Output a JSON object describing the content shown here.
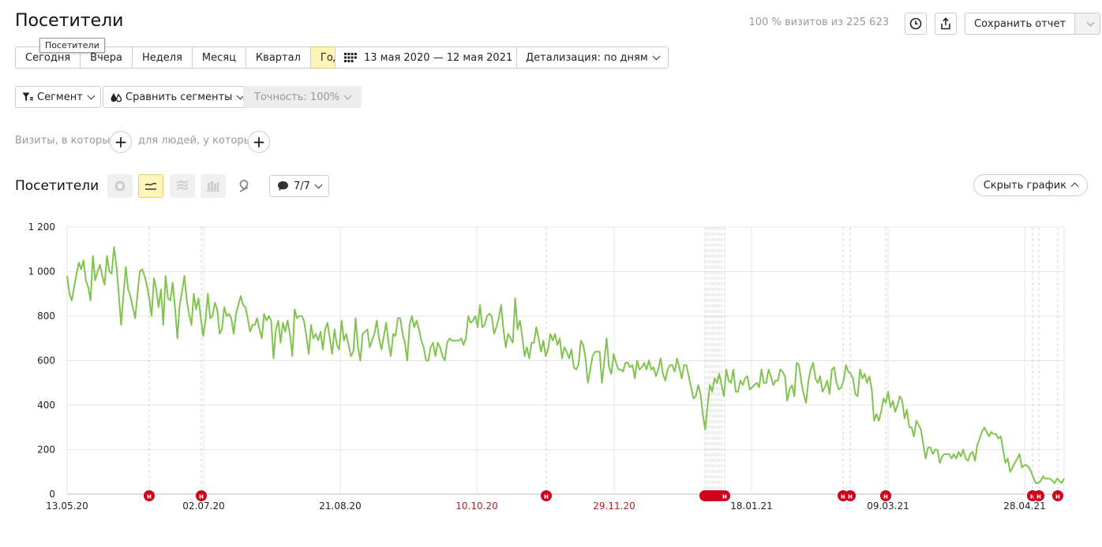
{
  "header": {
    "title": "Посетители",
    "tooltip": "Посетители",
    "visits_info": "100 % визитов из 225 623",
    "save_label": "Сохранить отчет"
  },
  "periods": [
    {
      "label": "Сегодня",
      "active": false
    },
    {
      "label": "Вчера",
      "active": false
    },
    {
      "label": "Неделя",
      "active": false
    },
    {
      "label": "Месяц",
      "active": false
    },
    {
      "label": "Квартал",
      "active": false
    },
    {
      "label": "Год",
      "active": true
    }
  ],
  "date_range": "13 мая 2020 — 12 мая 2021",
  "detail": "Детализация: по дням",
  "segment_label": "Сегмент",
  "compare_label": "Сравнить сегменты",
  "accuracy_label": "Точность: 100%",
  "filters": {
    "visits_label": "Визиты, в которых",
    "people_label": "для людей, у которых"
  },
  "chart_header": {
    "title": "Посетители",
    "notes_count": "7/7",
    "hide_label": "Скрыть график"
  },
  "colors": {
    "line": "#80c34e",
    "active_bg": "#fff5b8",
    "holiday_date": "#b22222",
    "marker": "#d0021b"
  },
  "chart_data": {
    "type": "line",
    "series": [
      {
        "values": [
          980,
          900,
          870,
          930,
          990,
          1040,
          1010,
          1050,
          960,
          930,
          870,
          1070,
          960,
          1000,
          1030,
          980,
          940,
          1070,
          1000,
          990,
          1110,
          1030,
          900,
          760,
          890,
          1020,
          920,
          890,
          840,
          790,
          900,
          1000,
          1010,
          980,
          940,
          880,
          800,
          970,
          920,
          840,
          920,
          760,
          980,
          880,
          870,
          950,
          840,
          700,
          850,
          910,
          980,
          870,
          810,
          760,
          900,
          830,
          880,
          790,
          710,
          780,
          900,
          790,
          800,
          860,
          830,
          720,
          740,
          840,
          800,
          810,
          790,
          720,
          810,
          850,
          890,
          850,
          840,
          790,
          730,
          760,
          760,
          790,
          740,
          700,
          810,
          780,
          800,
          780,
          610,
          740,
          780,
          680,
          770,
          730,
          780,
          720,
          620,
          830,
          790,
          800,
          800,
          780,
          710,
          630,
          760,
          700,
          720,
          690,
          730,
          650,
          740,
          770,
          700,
          630,
          740,
          670,
          650,
          780,
          690,
          720,
          670,
          620,
          640,
          790,
          660,
          600,
          720,
          730,
          740,
          660,
          690,
          720,
          780,
          700,
          650,
          710,
          770,
          680,
          620,
          720,
          710,
          790,
          790,
          720,
          680,
          600,
          760,
          800,
          750,
          780,
          740,
          690,
          660,
          600,
          600,
          660,
          680,
          620,
          680,
          660,
          620,
          600,
          680,
          700,
          690,
          690,
          690,
          690,
          700,
          670,
          700,
          800,
          770,
          780,
          800,
          750,
          850,
          750,
          760,
          800,
          810,
          800,
          720,
          750,
          790,
          850,
          740,
          660,
          720,
          700,
          680,
          880,
          740,
          780,
          710,
          620,
          660,
          610,
          680,
          680,
          750,
          700,
          640,
          690,
          620,
          650,
          720,
          690,
          720,
          670,
          700,
          610,
          660,
          640,
          610,
          650,
          570,
          560,
          580,
          690,
          670,
          610,
          500,
          560,
          620,
          640,
          640,
          640,
          500,
          600,
          700,
          570,
          540,
          630,
          590,
          560,
          560,
          550,
          590,
          590,
          570,
          580,
          520,
          600,
          560,
          570,
          590,
          560,
          600,
          560,
          570,
          530,
          560,
          610,
          540,
          510,
          560,
          580,
          580,
          550,
          610,
          570,
          520,
          580,
          580,
          530,
          480,
          430,
          440,
          490,
          450,
          360,
          290,
          400,
          490,
          460,
          520,
          500,
          540,
          490,
          440,
          560,
          510,
          500,
          560,
          460,
          460,
          510,
          490,
          520,
          530,
          470,
          480,
          490,
          500,
          480,
          560,
          500,
          500,
          560,
          530,
          490,
          510,
          510,
          560,
          550,
          530,
          420,
          470,
          490,
          440,
          590,
          580,
          500,
          450,
          410,
          510,
          560,
          590,
          520,
          500,
          530,
          460,
          480,
          510,
          450,
          560,
          570,
          500,
          470,
          480,
          510,
          580,
          550,
          540,
          520,
          450,
          440,
          560,
          520,
          540,
          500,
          530,
          470,
          330,
          360,
          330,
          370,
          430,
          410,
          460,
          390,
          420,
          370,
          400,
          440,
          420,
          340,
          380,
          300,
          300,
          260,
          330,
          310,
          290,
          220,
          160,
          210,
          210,
          180,
          200,
          200,
          140,
          170,
          180,
          180,
          180,
          160,
          180,
          160,
          190,
          170,
          200,
          160,
          150,
          180,
          190,
          150,
          220,
          250,
          280,
          300,
          280,
          260,
          280,
          270,
          270,
          250,
          260,
          200,
          140,
          160,
          100,
          120,
          140,
          160,
          180,
          120,
          130,
          130,
          120,
          100,
          70,
          50,
          50,
          60,
          80,
          70,
          70,
          70,
          60,
          50,
          70,
          60,
          50,
          70
        ]
      }
    ],
    "ylim": [
      0,
      1200
    ],
    "y_ticks": [
      "0",
      "200",
      "400",
      "600",
      "800",
      "1 000",
      "1 200"
    ],
    "x_ticks": [
      {
        "label": "13.05.20",
        "holiday": false
      },
      {
        "label": "02.07.20",
        "holiday": false
      },
      {
        "label": "21.08.20",
        "holiday": false
      },
      {
        "label": "10.10.20",
        "holiday": true
      },
      {
        "label": "29.11.20",
        "holiday": true
      },
      {
        "label": "18.01.21",
        "holiday": false
      },
      {
        "label": "09.03.21",
        "holiday": false
      },
      {
        "label": "28.04.21",
        "holiday": false
      }
    ],
    "grid": true,
    "annotations_label": "н"
  }
}
